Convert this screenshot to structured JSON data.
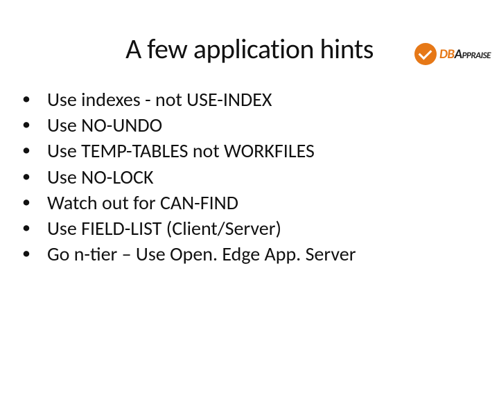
{
  "logo": {
    "db": "DB",
    "appraise": "Appraise"
  },
  "title": "A few application hints",
  "bullets": [
    "Use indexes - not USE-INDEX",
    "Use NO-UNDO",
    "Use TEMP-TABLES not WORKFILES",
    "Use NO-LOCK",
    "Watch out for CAN-FIND",
    "Use FIELD-LIST (Client/Server)",
    "Go n-tier – Use Open. Edge App. Server"
  ]
}
